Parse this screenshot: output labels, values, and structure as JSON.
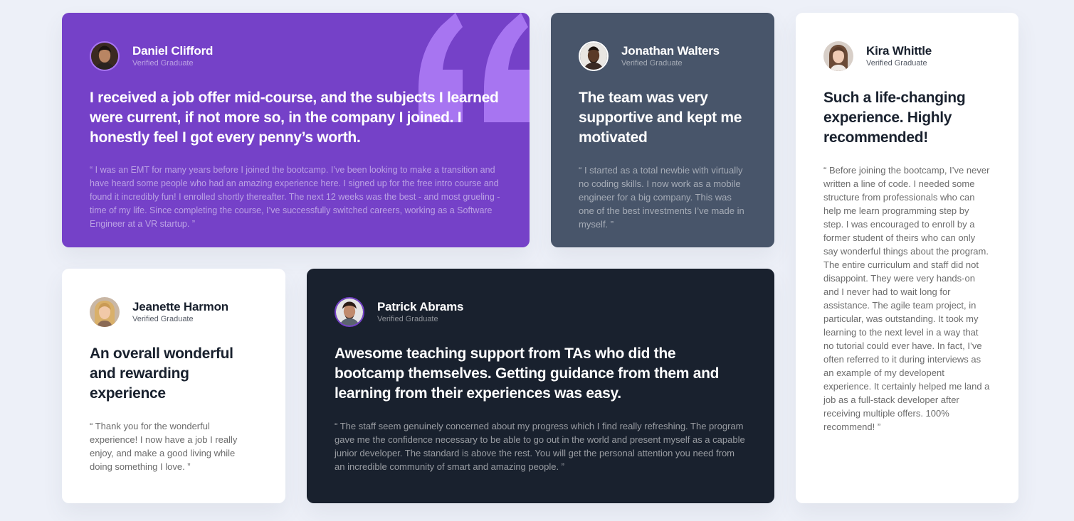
{
  "colors": {
    "background": "#edf0f8",
    "violet": "#7541c8",
    "grayish_blue": "#48556a",
    "blackish_blue": "#19212e",
    "white": "#ffffff",
    "quote_mark": "#a775f1"
  },
  "testimonials": [
    {
      "name": "Daniel Clifford",
      "status": "Verified Graduate",
      "headline": "I received a job offer mid-course, and the subjects I learned were current, if not more so, in the company I joined. I honestly feel I got every penny’s worth.",
      "quote": "“ I was an EMT for many years before I joined the bootcamp. I’ve been looking to make a transition and have heard some people who had an amazing experience here. I signed up for the free intro course and found it incredibly fun! I enrolled shortly thereafter. The next 12 weeks was the best - and most grueling - time of my life. Since completing the course, I’ve successfully switched careers, working as a Software Engineer at a VR startup. ”",
      "avatar": "man-avatar-icon"
    },
    {
      "name": "Jonathan Walters",
      "status": "Verified Graduate",
      "headline": "The team was very supportive and kept me motivated",
      "quote": "“ I started as a total newbie with virtually no coding skills. I now work as a mobile engineer for a big company. This was one of the best investments I’ve made in myself. ”",
      "avatar": "man-avatar-icon"
    },
    {
      "name": "Kira Whittle",
      "status": "Verified Graduate",
      "headline": "Such a life-changing experience. Highly recommended!",
      "quote": "“ Before joining the bootcamp, I’ve never written a line of code. I needed some structure from professionals who can help me learn programming step by step. I was encouraged to enroll by a former student of theirs who can only say wonderful things about the program. The entire curriculum and staff did not disappoint. They were very hands-on and I never had to wait long for assistance. The agile team project, in particular, was outstanding. It took my learning to the next level in a way that no tutorial could ever have. In fact, I’ve often referred to it during interviews as an example of my developent experience. It certainly helped me land a job as a full-stack developer after receiving multiple offers. 100% recommend! ”",
      "avatar": "woman-avatar-icon"
    },
    {
      "name": "Jeanette Harmon",
      "status": "Verified Graduate",
      "headline": "An overall wonderful and rewarding experience",
      "quote": "“ Thank you for the wonderful experience! I now have a job I really enjoy, and make a good living while doing something I love. ”",
      "avatar": "woman-avatar-icon"
    },
    {
      "name": "Patrick Abrams",
      "status": "Verified Graduate",
      "headline": "Awesome teaching support from TAs who did the bootcamp themselves. Getting guidance from them and learning from their experiences was easy.",
      "quote": "“ The staff seem genuinely concerned about my progress which I find really refreshing. The program gave me the confidence necessary to be able to go out in the world and present myself as a capable junior developer. The standard is above the rest. You will get the personal attention you need from an incredible community of smart and amazing people. ”",
      "avatar": "man-avatar-icon"
    }
  ]
}
